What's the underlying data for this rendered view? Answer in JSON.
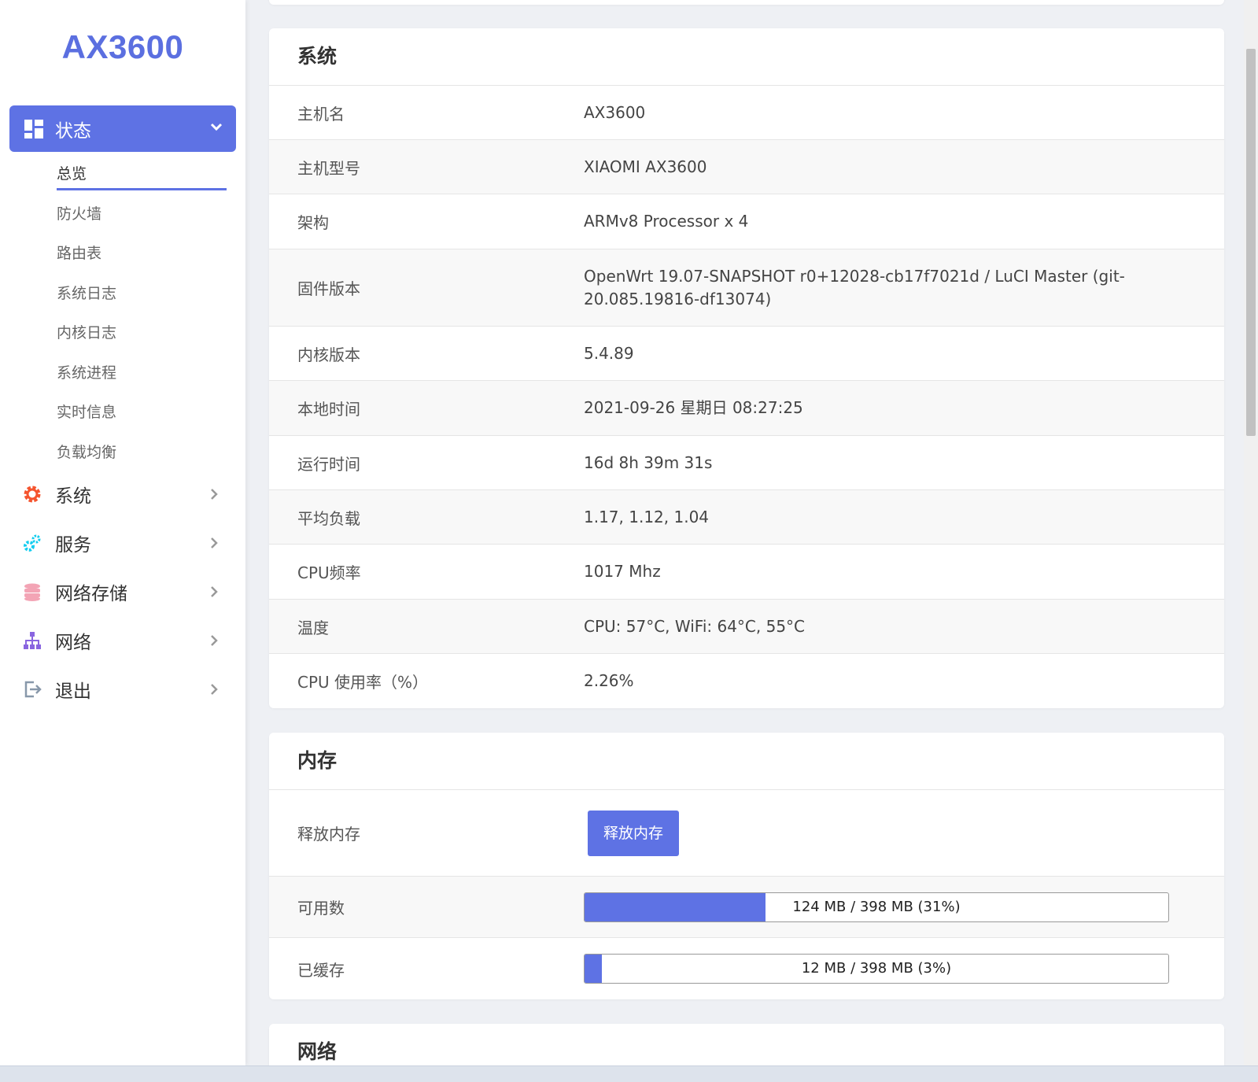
{
  "brand": "AX3600",
  "sidebar": {
    "active_menu": "状态",
    "submenu": [
      "总览",
      "防火墙",
      "路由表",
      "系统日志",
      "内核日志",
      "系统进程",
      "实时信息",
      "负载均衡"
    ],
    "menus": [
      {
        "label": "系统",
        "icon": "gear-icon",
        "color": "#f5542e"
      },
      {
        "label": "服务",
        "icon": "cogs-icon",
        "color": "#11cdef"
      },
      {
        "label": "网络存储",
        "icon": "database-icon",
        "color": "#f3a4b5"
      },
      {
        "label": "网络",
        "icon": "sitemap-icon",
        "color": "#8965e0"
      },
      {
        "label": "退出",
        "icon": "logout-icon",
        "color": "#8898aa"
      }
    ]
  },
  "system": {
    "title": "系统",
    "rows": [
      {
        "k": "主机名",
        "v": "AX3600"
      },
      {
        "k": "主机型号",
        "v": "XIAOMI AX3600"
      },
      {
        "k": "架构",
        "v": "ARMv8 Processor x 4"
      },
      {
        "k": "固件版本",
        "v": "OpenWrt 19.07-SNAPSHOT r0+12028-cb17f7021d / LuCI Master (git-20.085.19816-df13074)"
      },
      {
        "k": "内核版本",
        "v": "5.4.89"
      },
      {
        "k": "本地时间",
        "v": "2021-09-26 星期日 08:27:25"
      },
      {
        "k": "运行时间",
        "v": "16d 8h 39m 31s"
      },
      {
        "k": "平均负载",
        "v": "1.17, 1.12, 1.04"
      },
      {
        "k": "CPU频率",
        "v": "1017 Mhz"
      },
      {
        "k": "温度",
        "v": "CPU: 57°C, WiFi: 64°C, 55°C"
      },
      {
        "k": "CPU 使用率（%）",
        "v": "2.26%"
      }
    ]
  },
  "memory": {
    "title": "内存",
    "release_label": "释放内存",
    "release_button": "释放内存",
    "available": {
      "label": "可用数",
      "text": "124 MB / 398 MB (31%)",
      "fraction": 0.31
    },
    "cached": {
      "label": "已缓存",
      "text": "12 MB / 398 MB (3%)",
      "fraction": 0.03
    }
  },
  "network": {
    "title": "网络"
  },
  "colors": {
    "accent": "#5e72e4"
  }
}
